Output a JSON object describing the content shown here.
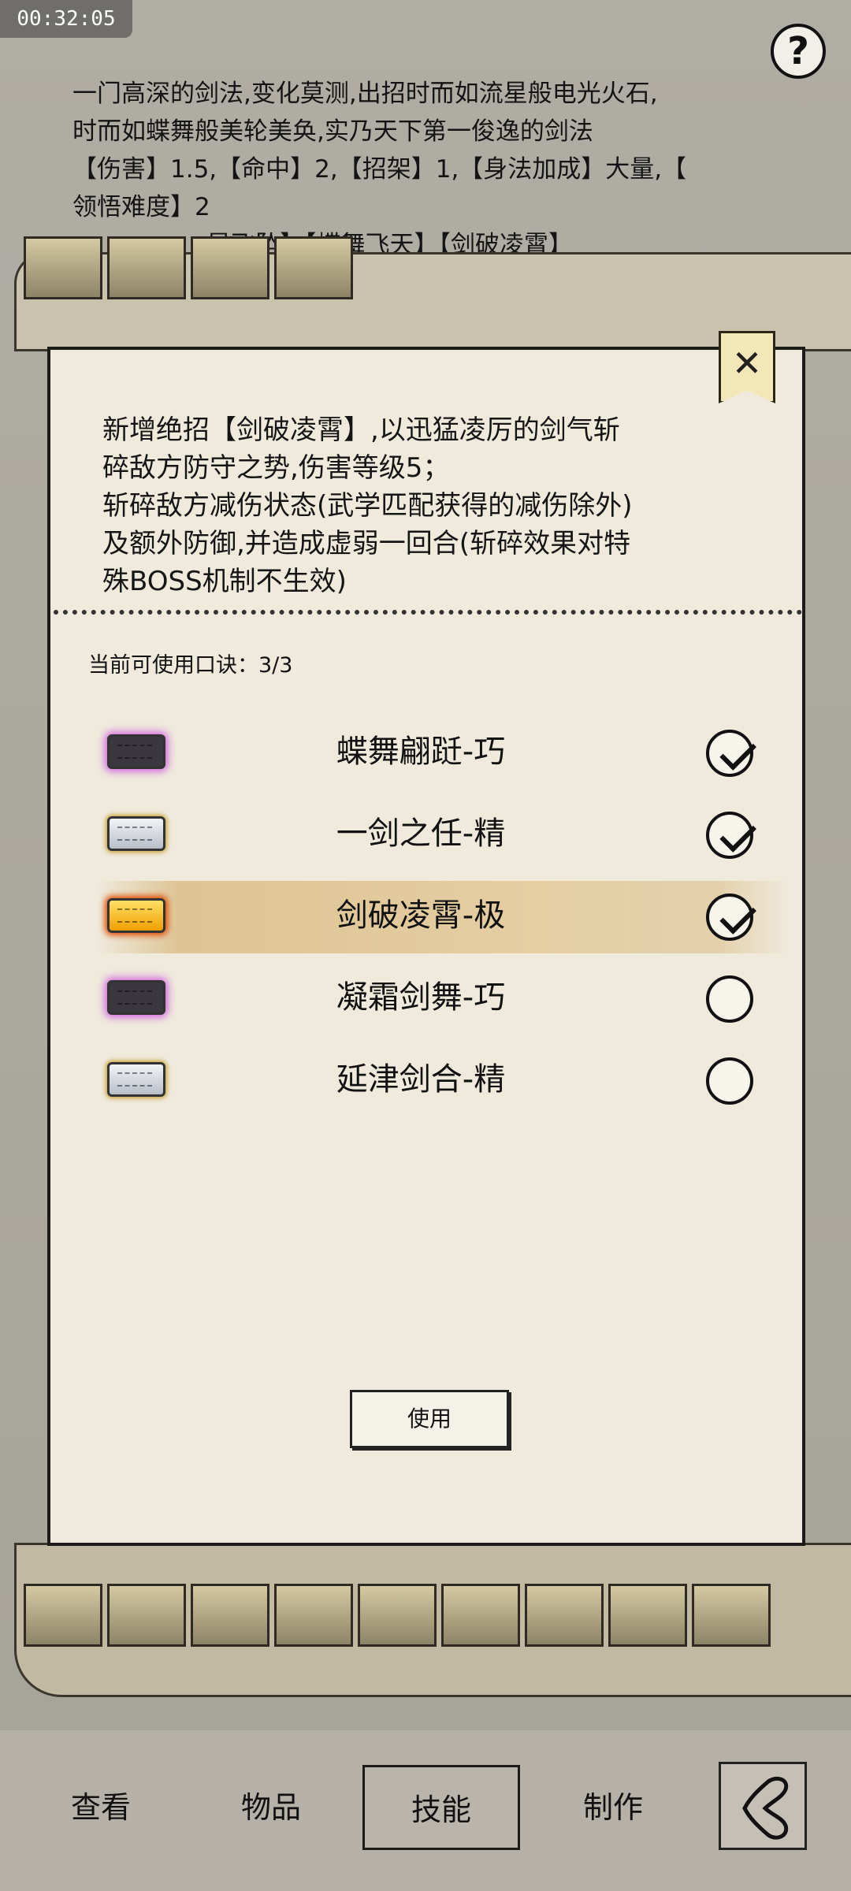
{
  "status": {
    "timer": "00:32:05"
  },
  "header": {
    "help_label": "?"
  },
  "description": {
    "lines": [
      "一门高深的剑法,变化莫测,出招时而如流星般电光火石,",
      "时而如蝶舞般美轮美奂,实乃天下第一俊逸的剑法",
      "【伤害】1.5,【命中】2,【招架】1,【身法加成】大量,【",
      "领悟难度】2"
    ],
    "moves_line": "星飞坠】【蝶舞飞天】【剑破凌霄】"
  },
  "dialog": {
    "close_label": "✕",
    "effect_lines": [
      "新增绝招【剑破凌霄】,以迅猛凌厉的剑气斩",
      "碎敌方防守之势,伤害等级5；",
      "斩碎敌方减伤状态(武学匹配获得的减伤除外)",
      "及额外防御,并造成虚弱一回合(斩碎效果对特",
      "殊BOSS机制不生效)"
    ],
    "count_label": "当前可使用口诀：",
    "count_value": "3/3",
    "items": [
      {
        "name": "蝶舞翩跹-巧",
        "chip": "purple",
        "checked": true
      },
      {
        "name": "一剑之任-精",
        "chip": "silver",
        "checked": true
      },
      {
        "name": "剑破凌霄-极",
        "chip": "gold",
        "checked": true,
        "highlighted": true
      },
      {
        "name": "凝霜剑舞-巧",
        "chip": "purple",
        "checked": false
      },
      {
        "name": "延津剑合-精",
        "chip": "silver",
        "checked": false
      }
    ],
    "use_button": "使用"
  },
  "tabs": [
    {
      "label": "查看",
      "active": false
    },
    {
      "label": "物品",
      "active": false
    },
    {
      "label": "技能",
      "active": true
    },
    {
      "label": "制作",
      "active": false
    }
  ],
  "back_icon": "back-arrow-icon"
}
